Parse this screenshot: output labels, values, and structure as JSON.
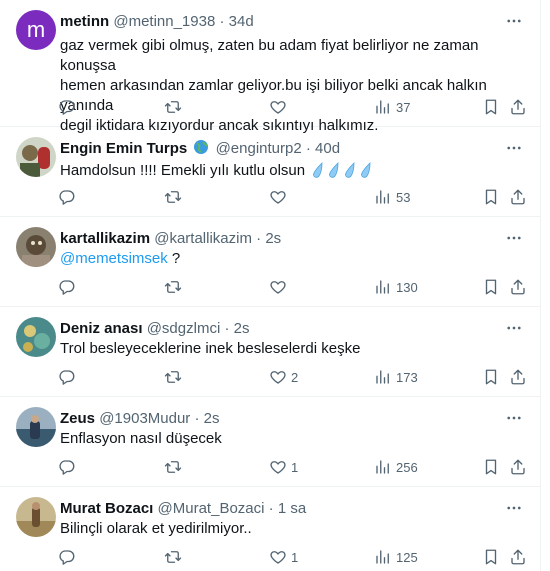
{
  "tweets": [
    {
      "name": "metinn",
      "handle": "@metinn_1938",
      "sep": "·",
      "time": "34d",
      "avatar_letter": "m",
      "lines": [
        "gaz vermek gibi olmuş, zaten bu adam fiyat belirliyor ne zaman konuşsa",
        "hemen arkasından zamlar geliyor.bu işi biliyor belki ancak halkın yanında",
        "degil iktidara kızıyordur ancak sıkıntıyı halkımız."
      ],
      "replies": "",
      "retweets": "",
      "likes": "",
      "views": "37"
    },
    {
      "name": "Engin Emin Turps",
      "handle": "@enginturp2",
      "sep": "·",
      "time": "40d",
      "text": "Hamdolsun !!!! Emekli yılı kutlu olsun",
      "replies": "",
      "retweets": "",
      "likes": "",
      "views": "53"
    },
    {
      "name": "kartallikazim",
      "handle": "@kartallikazim",
      "sep": "·",
      "time": "2s",
      "mention": "@memetsimsek",
      "text_after": " ?",
      "replies": "",
      "retweets": "",
      "likes": "",
      "views": "130"
    },
    {
      "name": "Deniz anası",
      "handle": "@sdgzlmci",
      "sep": "·",
      "time": "2s",
      "text": "Trol besleyeceklerine inek besleselerdi keşke",
      "replies": "",
      "retweets": "",
      "likes": "2",
      "views": "173"
    },
    {
      "name": "Zeus",
      "handle": "@1903Mudur",
      "sep": "·",
      "time": "2s",
      "text": "Enflasyon nasıl düşecek",
      "replies": "",
      "retweets": "",
      "likes": "1",
      "views": "256"
    },
    {
      "name": "Murat Bozacı",
      "handle": "@Murat_Bozaci",
      "sep": "·",
      "time": "1 sa",
      "text": "Bilinçli olarak et yedirilmiyor..",
      "replies": "",
      "retweets": "",
      "likes": "1",
      "views": "125"
    }
  ],
  "colors": {
    "text": "#0f1419",
    "secondary": "#536471",
    "link": "#1d9bf0",
    "avatar_purple": "#7b2cbf",
    "border": "#eff3f4"
  },
  "icons": [
    "reply-icon",
    "retweet-icon",
    "like-icon",
    "views-icon",
    "bookmark-icon",
    "share-icon",
    "more-icon",
    "globe-emoji-icon",
    "droplet-emoji-icon"
  ]
}
